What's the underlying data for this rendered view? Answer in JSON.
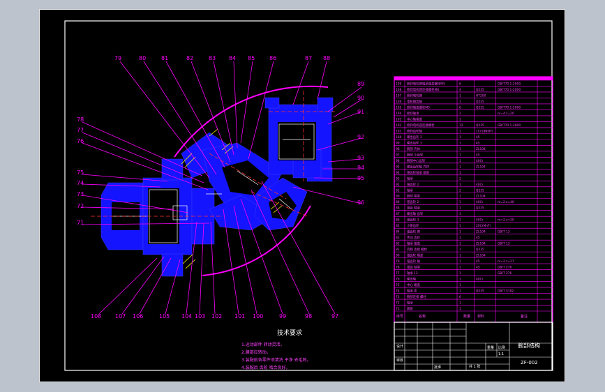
{
  "drawing": {
    "balloons_top": [
      "79",
      "80",
      "81",
      "82",
      "83",
      "84",
      "85",
      "86",
      "87",
      "88"
    ],
    "balloons_left": [
      "78",
      "77",
      "76",
      "75",
      "74",
      "73",
      "72",
      "71"
    ],
    "balloons_right": [
      "89",
      "90",
      "91",
      "92",
      "93",
      "94",
      "95",
      "96"
    ],
    "balloons_bottom": [
      "108",
      "107",
      "106",
      "105",
      "104",
      "103",
      "102",
      "101",
      "100",
      "99",
      "98",
      "97"
    ],
    "tech_title": "技术要求",
    "tech_notes": [
      "1.运动部件 转动灵活。",
      "2.腰部应转动。",
      "3.装配前各零件须清洗 干净 去毛刺。",
      "4.装配后 齿轮 啮合良好。"
    ]
  },
  "bom_rows": [
    [
      "109",
      "俯仰电机座轴承端盖螺栓M5",
      "6",
      "",
      "GB/T70.1-2000",
      ""
    ],
    [
      "108",
      "俯仰电机座连接螺栓M8",
      "4",
      "Q235",
      "GB/T70.1-2000",
      ""
    ],
    [
      "107",
      "俯仰电机座",
      "1",
      "HT200",
      "",
      ""
    ],
    [
      "106",
      "电机输出轴",
      "1",
      "Q235",
      "",
      ""
    ],
    [
      "105",
      "俯仰端盖螺栓M5",
      "6",
      "Q235",
      "GB/T70.1-2000",
      ""
    ],
    [
      "104",
      "俯仰轴承",
      "2",
      "",
      "m=4 z=20",
      ""
    ],
    [
      "103",
      "中心轴端盖",
      "1",
      "",
      "",
      ""
    ],
    [
      "102",
      "俯仰电机座连接螺栓",
      "12",
      "Q235",
      "GB/T70.1-2000",
      ""
    ],
    [
      "101",
      "俯仰齿轮轴",
      "1",
      "1Cr18Ni9Ti",
      "",
      ""
    ],
    [
      "100",
      "输出齿轮 2",
      "1",
      "45",
      "",
      ""
    ],
    [
      "99",
      "输出齿轮 3",
      "1",
      "45",
      "",
      ""
    ],
    [
      "98",
      "腕部 壳体",
      "1",
      "ZL104",
      "",
      ""
    ],
    [
      "97",
      "腕部 小齿轮",
      "1",
      "45",
      "",
      ""
    ],
    [
      "96",
      "腕部中心齿轮",
      "1",
      "40Cr",
      "",
      ""
    ],
    [
      "95",
      "输出齿轮轴 壳体",
      "1",
      "ZL104",
      "",
      ""
    ],
    [
      "94",
      "锥齿轮轴承 端盖",
      "1",
      "",
      "",
      ""
    ],
    [
      "93",
      "轴承",
      "2",
      "",
      "",
      ""
    ],
    [
      "92",
      "锥齿轮 2",
      "1",
      "40Cr",
      "",
      ""
    ],
    [
      "91",
      "轴承",
      "2",
      "Q235",
      "",
      ""
    ],
    [
      "90",
      "腕部 端盖",
      "1",
      "ZL104",
      "",
      ""
    ],
    [
      "89",
      "锥齿轮 2",
      "1",
      "40Cr",
      "m=2 z=40",
      ""
    ],
    [
      "88",
      "锥齿 轴承",
      "1",
      "Q235",
      "",
      ""
    ],
    [
      "87",
      "输出轴 齿轮",
      "1",
      "",
      "",
      ""
    ],
    [
      "86",
      "锥齿轮 3",
      "1",
      "40Cr",
      "m=2 z=20",
      ""
    ],
    [
      "85",
      "小锥齿轮",
      "1",
      "20CrMnTi",
      "",
      ""
    ],
    [
      "84",
      "锥齿轮 座",
      "1",
      "ZL104",
      "GB/T 13",
      ""
    ],
    [
      "83",
      "传动 齿轮",
      "1",
      "45",
      "",
      ""
    ],
    [
      "82",
      "轴承 端盖",
      "1",
      "ZL104",
      "GB/T 13",
      ""
    ],
    [
      "81",
      "内侧 连接 螺栓",
      "1",
      "Q235",
      "",
      ""
    ],
    [
      "80",
      "锥齿轮 端盖",
      "1",
      "ZL104",
      "",
      ""
    ],
    [
      "79",
      "锥齿轮 轴",
      "1",
      "45",
      "m=2 z=27",
      ""
    ],
    [
      "78",
      "锥齿 轴承",
      "1",
      "45",
      "GB/T 276",
      ""
    ],
    [
      "77",
      "轴承 12",
      "1",
      "",
      "GB/T 276",
      ""
    ],
    [
      "76",
      "输出轴",
      "1",
      "40Cr",
      "",
      ""
    ],
    [
      "75",
      "中心 端盖",
      "1",
      "",
      "",
      ""
    ],
    [
      "74",
      "轴承 盖",
      "1",
      "Q235",
      "GB/T 5782",
      ""
    ],
    [
      "73",
      "腕部连接 螺栓",
      "6",
      "",
      "",
      ""
    ],
    [
      "72",
      "轴承",
      "1",
      "",
      "",
      ""
    ],
    [
      "71",
      "端盖",
      "1",
      "",
      "",
      ""
    ]
  ],
  "bom_header": {
    "no": "序号",
    "name": "名称",
    "qty": "数量",
    "material": "材料",
    "note": "备注"
  },
  "title_block": {
    "drawing_name": "腕部结构",
    "drawing_no": "ZF-002",
    "scale": "1:1",
    "sheet": "共 1 张",
    "designer": "设计",
    "check": "审核",
    "approve": "批准",
    "weight": "重量",
    "ratio": "比例"
  },
  "colors": {
    "background": "#000000",
    "outer_bg": "#bcc3cd",
    "frame": "#ffffff",
    "part_fill": "#1414ff",
    "leader": "#ff00ff",
    "table_line": "#ff00ff",
    "table_text": "#ff40ff",
    "hatch": "#ffff00"
  }
}
